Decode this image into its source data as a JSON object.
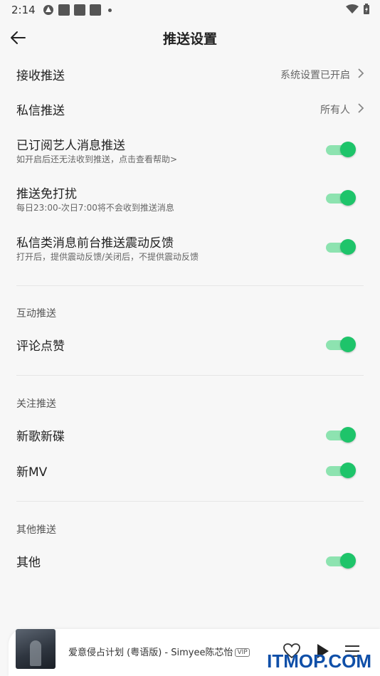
{
  "status_bar": {
    "time": "2:14"
  },
  "header": {
    "title": "推送设置"
  },
  "settings": {
    "receive_push": {
      "label": "接收推送",
      "value": "系统设置已开启"
    },
    "dm_push": {
      "label": "私信推送",
      "value": "所有人"
    },
    "artist_push": {
      "label": "已订阅艺人消息推送",
      "sub": "如开启后还无法收到推送，点击查看帮助>",
      "enabled": true
    },
    "dnd": {
      "label": "推送免打扰",
      "sub": "每日23:00-次日7:00将不会收到推送消息",
      "enabled": true
    },
    "dm_vibrate": {
      "label": "私信类消息前台推送震动反馈",
      "sub": "打开后，提供震动反馈/关闭后，不提供震动反馈",
      "enabled": true
    }
  },
  "sections": {
    "interaction": {
      "title": "互动推送",
      "items": [
        {
          "label": "评论点赞",
          "enabled": true
        }
      ]
    },
    "follow": {
      "title": "关注推送",
      "items": [
        {
          "label": "新歌新碟",
          "enabled": true
        },
        {
          "label": "新MV",
          "enabled": true
        }
      ]
    },
    "other": {
      "title": "其他推送",
      "items": [
        {
          "label": "其他",
          "enabled": true
        }
      ]
    }
  },
  "player": {
    "song": "爱意侵占计划 (粤语版) - Simyee陈芯怡",
    "badge": "VIP"
  },
  "watermark": "ITMOP.COM",
  "colors": {
    "toggle_on": "#1ec46a",
    "toggle_track": "#8de3b0",
    "background": "#f7f7f7"
  }
}
